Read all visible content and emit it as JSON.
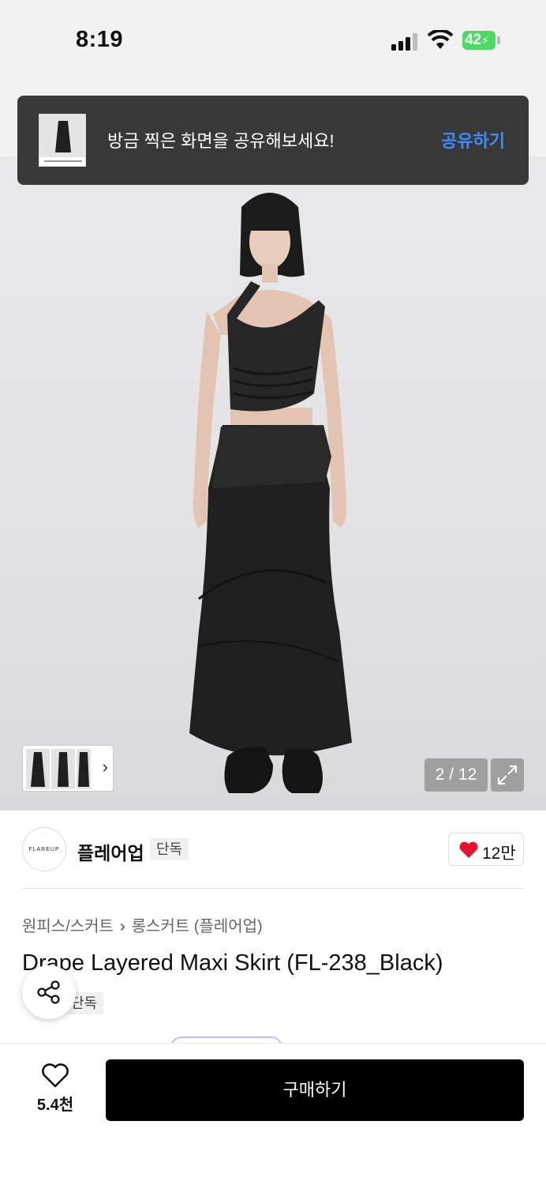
{
  "status_bar": {
    "time": "8:19",
    "battery": "42"
  },
  "toast": {
    "message": "방금 찍은 화면을 공유해보세요!",
    "action": "공유하기"
  },
  "gallery": {
    "counter": "2 / 12"
  },
  "brand": {
    "logo_text": "FLAREUP",
    "name": "플레어업",
    "badge": "단독",
    "likes": "12만"
  },
  "breadcrumb": {
    "category": "원피스/스커트",
    "subcategory": "롱스커트 (플레어업)"
  },
  "product": {
    "title": "Drape Layered Maxi Skirt (FL-238_Black)",
    "tag": "단독"
  },
  "bottom_bar": {
    "wish_count": "5.4천",
    "buy_label": "구매하기"
  },
  "colors": {
    "accent": "#3d8bff",
    "heart": "#e8102a",
    "buy_button": "#000000"
  }
}
